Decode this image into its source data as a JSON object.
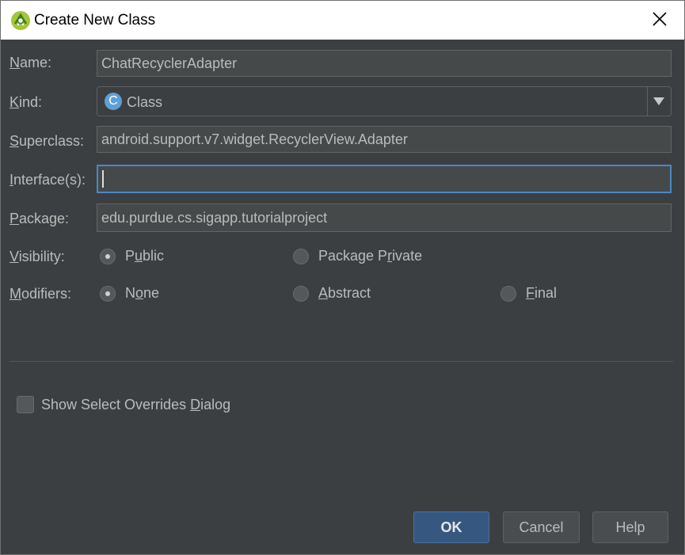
{
  "window": {
    "title": "Create New Class"
  },
  "form": {
    "name": {
      "label_first": "N",
      "label_rest": "ame:",
      "value": "ChatRecyclerAdapter"
    },
    "kind": {
      "label_first": "K",
      "label_rest": "ind:",
      "value": "Class",
      "icon_letter": "C"
    },
    "superclass": {
      "label_first": "S",
      "label_rest": "uperclass:",
      "value": "android.support.v7.widget.RecyclerView.Adapter"
    },
    "interfaces": {
      "label_first": "I",
      "label_rest": "nterface(s):",
      "value": ""
    },
    "package": {
      "label_first": "P",
      "label_rest": "ackage:",
      "value": "edu.purdue.cs.sigapp.tutorialproject"
    },
    "visibility": {
      "label_first": "V",
      "label_rest": "isibility:",
      "options": [
        {
          "pre": "P",
          "ul": "u",
          "post": "blic",
          "selected": true
        },
        {
          "pre": "Package P",
          "ul": "r",
          "post": "ivate",
          "selected": false
        }
      ]
    },
    "modifiers": {
      "label_first": "M",
      "label_rest": "odifiers:",
      "options": [
        {
          "pre": "N",
          "ul": "o",
          "post": "ne",
          "selected": true
        },
        {
          "pre": "",
          "ul": "A",
          "post": "bstract",
          "selected": false
        },
        {
          "pre": "",
          "ul": "F",
          "post": "inal",
          "selected": false
        }
      ]
    },
    "show_overrides": {
      "pre": "Show Select Overrides ",
      "ul": "D",
      "post": "ialog",
      "checked": false
    }
  },
  "buttons": {
    "ok": "OK",
    "cancel": "Cancel",
    "help": "Help"
  },
  "colors": {
    "background": "#3c3f41",
    "field": "#45494a",
    "focus": "#4a88c7",
    "default_button": "#365880",
    "text": "#bbbbbb",
    "android_green": "#a4c639"
  }
}
